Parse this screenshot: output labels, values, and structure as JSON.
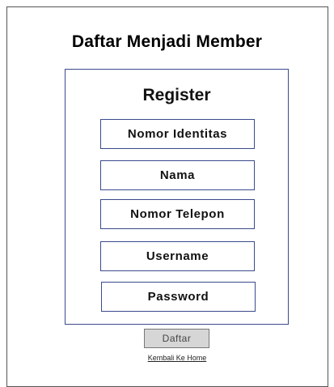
{
  "page": {
    "title": "Daftar Menjadi Member"
  },
  "register": {
    "title": "Register",
    "fields": [
      {
        "label": "Nomor Identitas"
      },
      {
        "label": "Nama"
      },
      {
        "label": "Nomor Telepon"
      },
      {
        "label": "Username"
      },
      {
        "label": "Password"
      }
    ]
  },
  "actions": {
    "submit_label": "Daftar",
    "home_link_label": "Kembali Ke Home"
  },
  "colors": {
    "border_accent": "#3b4a8c",
    "button_bg": "#d6d6d6"
  }
}
